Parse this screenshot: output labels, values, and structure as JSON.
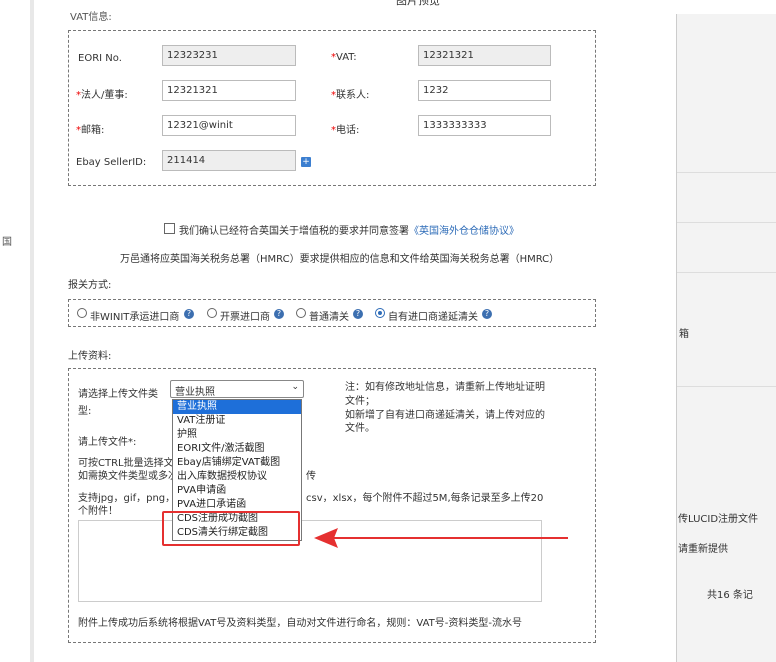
{
  "top_title": "图片预览",
  "left_bg": [
    "国"
  ],
  "right_bg": [
    "箱",
    "传LUCID注册文件",
    "请重新提供",
    "共16 条记"
  ],
  "vat_section": {
    "legend": "VAT信息:",
    "eori_label": "EORI No.",
    "eori_value": "12323231",
    "vat_label": "VAT:",
    "vat_value": "12321321",
    "legal_label": "法人/董事:",
    "legal_value": "12321321",
    "contact_label": "联系人:",
    "contact_value": "1232",
    "email_label": "邮箱:",
    "email_value": "12321@winit",
    "phone_label": "电话:",
    "phone_value": "1333333333",
    "ebay_label": "Ebay SellerID:",
    "ebay_value": "211414",
    "plus_glyph": "+"
  },
  "agreement": {
    "text": "我们确认已经符合英国关于增值税的要求并同意签署",
    "link": "《英国海外仓仓储协议》"
  },
  "hmrc_notice": "万邑通将应英国海关税务总署（HMRC）要求提供相应的信息和文件给英国海关税务总署（HMRC）",
  "customs": {
    "label": "报关方式:",
    "options": [
      "非WINIT承运进口商",
      "开票进口商",
      "普通清关",
      "自有进口商递延清关"
    ],
    "help": "?"
  },
  "upload": {
    "label": "上传资料:",
    "type_label_1": "请选择上传文件类",
    "type_label_2": "型:",
    "selected": "营业执照",
    "chevron": "⌄",
    "note_1": "注：如有修改地址信息，请重新上传地址证明",
    "note_2": "文件；",
    "note_3": "如新增了自有进口商递延清关，请上传对应的",
    "note_4": "文件。",
    "file_label": "请上传文件*:",
    "batch_1": "可按CTRL批量选择文",
    "batch_2": "如需换文件类型或多次",
    "batch_tail": "传",
    "support_1": "支持jpg，gif，png，",
    "support_1b": "csv，xlsx，每个附件不超过5M,每条记录至多上传20",
    "support_2": "个附件！",
    "footer": "附件上传成功后系统将根据VAT号及资料类型，自动对文件进行命名，规则：VAT号-资料类型-流水号",
    "dropdown": [
      "营业执照",
      "VAT注册证",
      "护照",
      "EORI文件/激活截图",
      "Ebay店铺绑定VAT截图",
      "出入库数据授权协议",
      "PVA申请函",
      "PVA进口承诺函",
      "CDS注册成功截图",
      "CDS清关行绑定截图"
    ]
  }
}
